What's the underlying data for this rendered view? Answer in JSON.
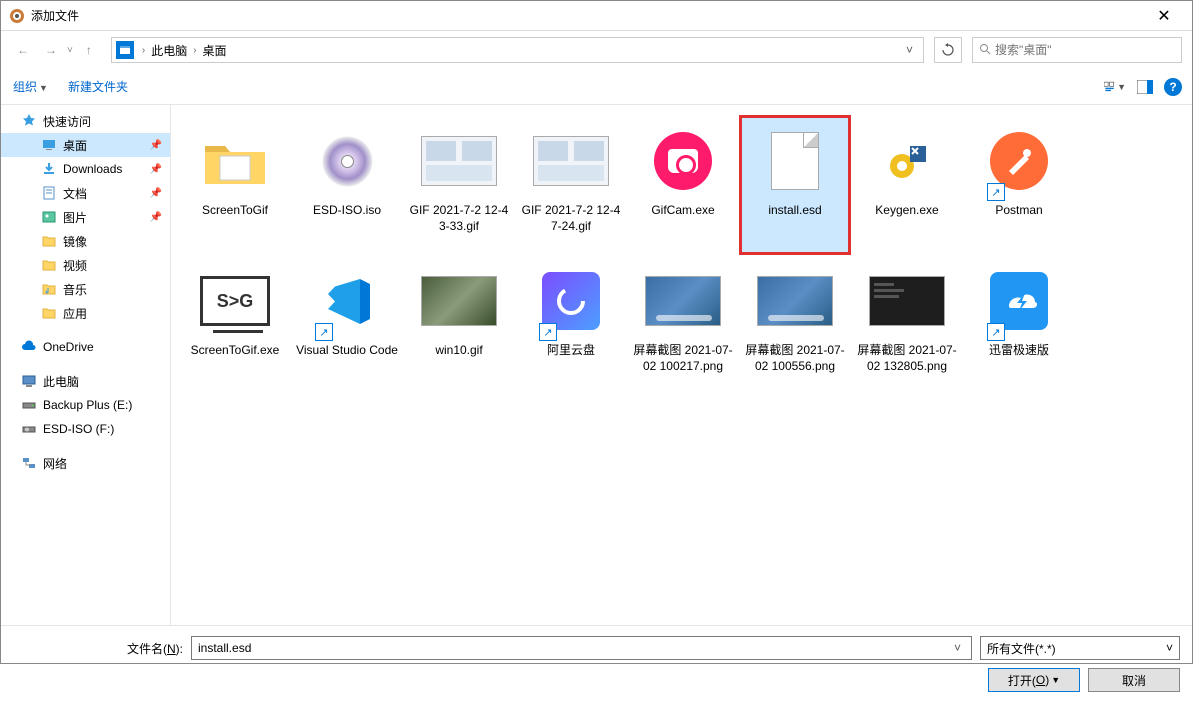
{
  "window": {
    "title": "添加文件",
    "close_label": "✕"
  },
  "nav": {
    "breadcrumb": [
      "此电脑",
      "桌面"
    ],
    "search_placeholder": "搜索\"桌面\""
  },
  "toolbar": {
    "organize": "组织",
    "new_folder": "新建文件夹"
  },
  "sidebar": {
    "quick_access": "快速访问",
    "items_qa": [
      {
        "label": "桌面",
        "icon": "desktop",
        "pinned": true,
        "selected": true
      },
      {
        "label": "Downloads",
        "icon": "downloads",
        "pinned": true
      },
      {
        "label": "文档",
        "icon": "documents",
        "pinned": true
      },
      {
        "label": "图片",
        "icon": "pictures",
        "pinned": true
      },
      {
        "label": "镜像",
        "icon": "folder"
      },
      {
        "label": "视频",
        "icon": "folder"
      },
      {
        "label": "音乐",
        "icon": "folder-music"
      },
      {
        "label": "应用",
        "icon": "folder"
      }
    ],
    "onedrive": "OneDrive",
    "this_pc": "此电脑",
    "drives": [
      {
        "label": "Backup Plus (E:)",
        "icon": "drive"
      },
      {
        "label": "ESD-ISO (F:)",
        "icon": "disc-drive"
      }
    ],
    "network": "网络"
  },
  "files": [
    {
      "name": "ScreenToGif",
      "type": "folder"
    },
    {
      "name": "ESD-ISO.iso",
      "type": "disc"
    },
    {
      "name": "GIF 2021-7-2 12-43-33.gif",
      "type": "thumb-light"
    },
    {
      "name": "GIF 2021-7-2 12-47-24.gif",
      "type": "thumb-light"
    },
    {
      "name": "GifCam.exe",
      "type": "gifcam"
    },
    {
      "name": "install.esd",
      "type": "blank",
      "selected": true,
      "highlighted": true
    },
    {
      "name": "Keygen.exe",
      "type": "keygen"
    },
    {
      "name": "Postman",
      "type": "postman",
      "shortcut": true
    },
    {
      "name": "ScreenToGif.exe",
      "type": "stg"
    },
    {
      "name": "Visual Studio Code",
      "type": "vscode",
      "shortcut": true
    },
    {
      "name": "win10.gif",
      "type": "thumb-colorful"
    },
    {
      "name": "阿里云盘",
      "type": "aliyun",
      "shortcut": true
    },
    {
      "name": "屏幕截图 2021-07-02 100217.png",
      "type": "thumb-win11"
    },
    {
      "name": "屏幕截图 2021-07-02 100556.png",
      "type": "thumb-win11"
    },
    {
      "name": "屏幕截图 2021-07-02 132805.png",
      "type": "thumb-dark"
    },
    {
      "name": "迅雷极速版",
      "type": "thunder",
      "shortcut": true
    }
  ],
  "footer": {
    "filename_label_pre": "文件名(",
    "filename_label_key": "N",
    "filename_label_post": "):",
    "filename_value": "install.esd",
    "filter": "所有文件(*.*)",
    "open_pre": "打开(",
    "open_key": "O",
    "open_post": ")",
    "cancel": "取消"
  }
}
